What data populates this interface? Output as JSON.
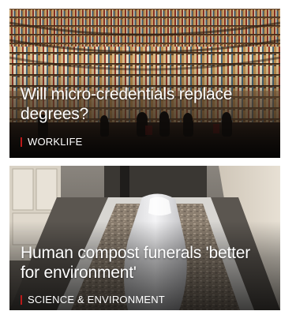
{
  "stories": [
    {
      "headline": "Will micro-credentials replace degrees?",
      "section": "WORKLIFE",
      "image": "library-bookshelves-photo"
    },
    {
      "headline": "Human compost funerals 'better for environment'",
      "section": "SCIENCE & ENVIRONMENT",
      "image": "compost-vessel-photo"
    }
  ],
  "colors": {
    "section_marker": "#bb1919",
    "text": "#ffffff"
  }
}
